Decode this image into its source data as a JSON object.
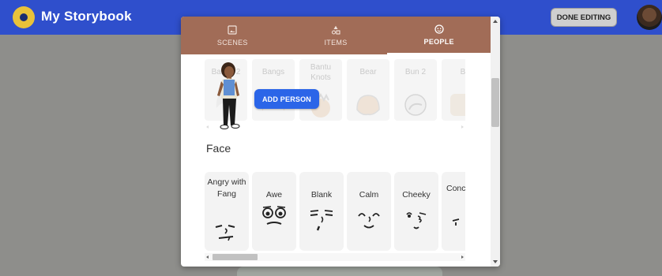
{
  "app": {
    "title": "My Storybook",
    "done_label": "DONE EDITING",
    "logo_icon": "storybook-logo-icon",
    "avatar_icon": "user-avatar"
  },
  "colors": {
    "appbar": "#2f4fcc",
    "tab_bar": "#a16c57",
    "add_button": "#2b65e8",
    "backdrop": "#8e8e8b"
  },
  "tabs": [
    {
      "label": "SCENES",
      "icon": "image-icon",
      "active": false
    },
    {
      "label": "ITEMS",
      "icon": "shapes-icon",
      "active": false
    },
    {
      "label": "PEOPLE",
      "icon": "face-icon",
      "active": true
    }
  ],
  "hair": {
    "items": [
      {
        "label": "Bangs 2"
      },
      {
        "label": "Bangs"
      },
      {
        "label": "Bantu Knots"
      },
      {
        "label": "Bear"
      },
      {
        "label": "Bun 2"
      },
      {
        "label": "B"
      }
    ],
    "add_person_label": "ADD PERSON"
  },
  "face": {
    "title": "Face",
    "items": [
      {
        "label": "Angry with Fang"
      },
      {
        "label": "Awe"
      },
      {
        "label": "Blank"
      },
      {
        "label": "Calm"
      },
      {
        "label": "Cheeky"
      },
      {
        "label": "Conc F"
      }
    ]
  }
}
